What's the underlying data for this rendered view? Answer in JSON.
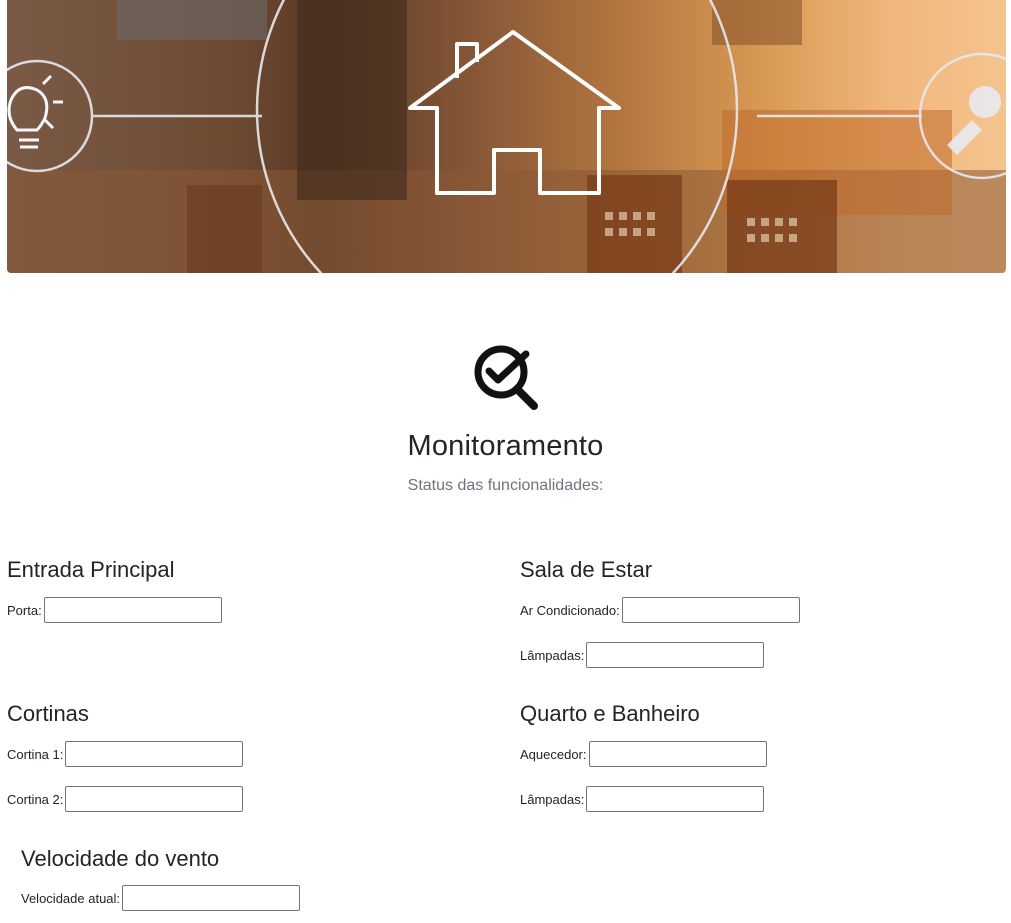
{
  "hero": {
    "image": "smart-home-banner"
  },
  "header": {
    "icon": "magnifier-check-icon",
    "title": "Monitoramento",
    "subtitle": "Status das funcionalidades:"
  },
  "sections": {
    "entrada": {
      "title": "Entrada Principal",
      "fields": [
        {
          "label": "Porta:",
          "value": ""
        }
      ]
    },
    "sala": {
      "title": "Sala de Estar",
      "fields": [
        {
          "label": "Ar Condicionado:",
          "value": ""
        },
        {
          "label": "Lâmpadas:",
          "value": ""
        }
      ]
    },
    "cortinas": {
      "title": "Cortinas",
      "fields": [
        {
          "label": "Cortina 1:",
          "value": ""
        },
        {
          "label": "Cortina 2:",
          "value": ""
        }
      ]
    },
    "quarto": {
      "title": "Quarto e Banheiro",
      "fields": [
        {
          "label": "Aquecedor:",
          "value": ""
        },
        {
          "label": "Lâmpadas:",
          "value": ""
        }
      ]
    },
    "vento": {
      "title": "Velocidade do vento",
      "fields": [
        {
          "label": "Velocidade atual:",
          "value": ""
        }
      ]
    }
  }
}
